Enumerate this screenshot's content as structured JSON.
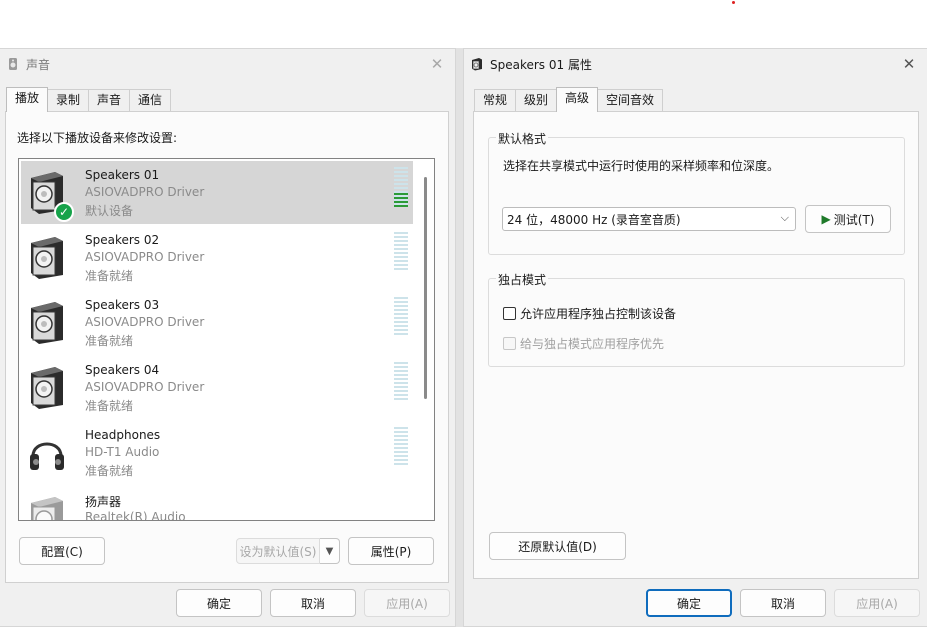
{
  "left_dialog": {
    "title": "声音",
    "tabs": [
      {
        "label": "播放",
        "active": true
      },
      {
        "label": "录制",
        "active": false
      },
      {
        "label": "声音",
        "active": false
      },
      {
        "label": "通信",
        "active": false
      }
    ],
    "instruction": "选择以下播放设备来修改设置:",
    "devices": [
      {
        "name": "Speakers 01",
        "driver": "ASIOVADPRO Driver",
        "status": "默认设备",
        "icon": "speaker-icon",
        "level": 0.35,
        "selected": true,
        "default": true
      },
      {
        "name": "Speakers 02",
        "driver": "ASIOVADPRO Driver",
        "status": "准备就绪",
        "icon": "speaker-icon",
        "level": 0
      },
      {
        "name": "Speakers 03",
        "driver": "ASIOVADPRO Driver",
        "status": "准备就绪",
        "icon": "speaker-icon",
        "level": 0
      },
      {
        "name": "Speakers 04",
        "driver": "ASIOVADPRO Driver",
        "status": "准备就绪",
        "icon": "speaker-icon",
        "level": 0
      },
      {
        "name": "Headphones",
        "driver": "HD-T1 Audio",
        "status": "准备就绪",
        "icon": "headphones-icon",
        "level": 0
      },
      {
        "name": "扬声器",
        "driver": "Realtek(R) Audio",
        "status": "",
        "icon": "speaker-icon",
        "level": 0
      }
    ],
    "buttons": {
      "configure": "配置(C)",
      "set_default": "设为默认值(S)",
      "properties": "属性(P)",
      "ok": "确定",
      "cancel": "取消",
      "apply": "应用(A)"
    }
  },
  "right_dialog": {
    "title": "Speakers 01 属性",
    "tabs": [
      {
        "label": "常规",
        "active": false
      },
      {
        "label": "级别",
        "active": false
      },
      {
        "label": "高级",
        "active": true
      },
      {
        "label": "空间音效",
        "active": false
      }
    ],
    "default_format": {
      "group_label": "默认格式",
      "description": "选择在共享模式中运行时使用的采样频率和位深度。",
      "selected_format": "24 位，48000 Hz (录音室音质)",
      "test_button": "测试(T)"
    },
    "exclusive_mode": {
      "group_label": "独占模式",
      "allow_exclusive": {
        "label": "允许应用程序独占控制该设备",
        "checked": false,
        "enabled": true
      },
      "give_priority": {
        "label": "给与独占模式应用程序优先",
        "checked": false,
        "enabled": false
      }
    },
    "buttons": {
      "restore_defaults": "还原默认值(D)",
      "ok": "确定",
      "cancel": "取消",
      "apply": "应用(A)"
    }
  },
  "colors": {
    "accent": "#0f6cbd",
    "selected_row": "#d6d6d6",
    "meter_active": "#2c9a36",
    "default_check": "#16a34a"
  }
}
